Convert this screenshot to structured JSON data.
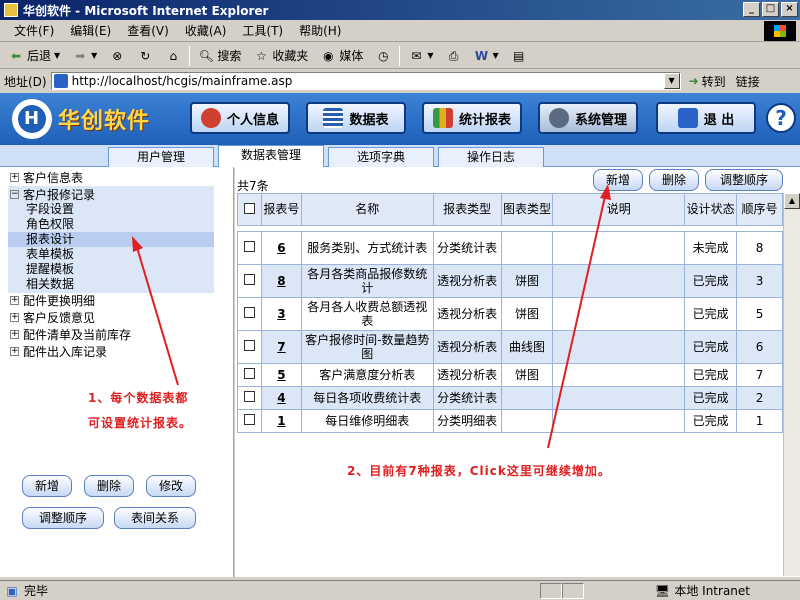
{
  "window": {
    "title": "华创软件 - Microsoft Internet Explorer",
    "min": "_",
    "max": "□",
    "close": "×"
  },
  "menu": [
    "文件(F)",
    "编辑(E)",
    "查看(V)",
    "收藏(A)",
    "工具(T)",
    "帮助(H)"
  ],
  "toolbar": {
    "back": "后退",
    "search": "搜索",
    "favorites": "收藏夹",
    "media": "媒体"
  },
  "address": {
    "label": "地址(D)",
    "url": "http://localhost/hcgis/mainframe.asp",
    "go": "转到",
    "links": "链接"
  },
  "app": {
    "logo_text": "华创软件",
    "nav": [
      {
        "label": "个人信息",
        "color": "#d04030"
      },
      {
        "label": "数据表",
        "color": "#2a5fb0"
      },
      {
        "label": "统计报表",
        "color": "#3a9a40"
      },
      {
        "label": "系统管理",
        "color": "#5a6a80"
      },
      {
        "label": "退  出",
        "color": "#2a63c8"
      }
    ],
    "help": "?"
  },
  "subtabs": [
    "用户管理",
    "数据表管理",
    "选项字典",
    "操作日志"
  ],
  "tree": {
    "top": [
      "客户信息表"
    ],
    "expanded": {
      "label": "客户报修记录",
      "children": [
        "字段设置",
        "角色权限",
        "报表设计",
        "表单模板",
        "提醒模板",
        "相关数据"
      ]
    },
    "rest": [
      "配件更换明细",
      "客户反馈意见",
      "配件清单及当前库存",
      "配件出入库记录"
    ]
  },
  "annotations": {
    "left_line1": "1、每个数据表都",
    "left_line2": "可设置统计报表。",
    "right": "2、目前有7种报表，Click这里可继续增加。"
  },
  "left_buttons": {
    "add": "新增",
    "delete": "删除",
    "edit": "修改",
    "reorder": "调整顺序",
    "relation": "表间关系"
  },
  "grid": {
    "count": "共7条",
    "actions": {
      "add": "新增",
      "delete": "删除",
      "reorder": "调整顺序"
    },
    "headers": {
      "id": "报表号",
      "name": "名称",
      "type": "报表类型",
      "chart": "图表类型",
      "desc": "说明",
      "status": "设计状态",
      "order": "顺序号"
    },
    "rows": [
      {
        "id": "6",
        "name": "服务类别、方式统计表",
        "type": "分类统计表",
        "chart": "",
        "status": "未完成",
        "order": "8"
      },
      {
        "id": "8",
        "name": "各月各类商品报修数统计",
        "type": "透视分析表",
        "chart": "饼图",
        "status": "已完成",
        "order": "3"
      },
      {
        "id": "3",
        "name": "各月各人收费总额透视表",
        "type": "透视分析表",
        "chart": "饼图",
        "status": "已完成",
        "order": "5"
      },
      {
        "id": "7",
        "name": "客户报修时间-数量趋势图",
        "type": "透视分析表",
        "chart": "曲线图",
        "status": "已完成",
        "order": "6"
      },
      {
        "id": "5",
        "name": "客户满意度分析表",
        "type": "透视分析表",
        "chart": "饼图",
        "status": "已完成",
        "order": "7"
      },
      {
        "id": "4",
        "name": "每日各项收费统计表",
        "type": "分类统计表",
        "chart": "",
        "status": "已完成",
        "order": "2"
      },
      {
        "id": "1",
        "name": "每日维修明细表",
        "type": "分类明细表",
        "chart": "",
        "status": "已完成",
        "order": "1"
      }
    ]
  },
  "status": {
    "left": "完毕",
    "zone": "本地 Intranet"
  }
}
